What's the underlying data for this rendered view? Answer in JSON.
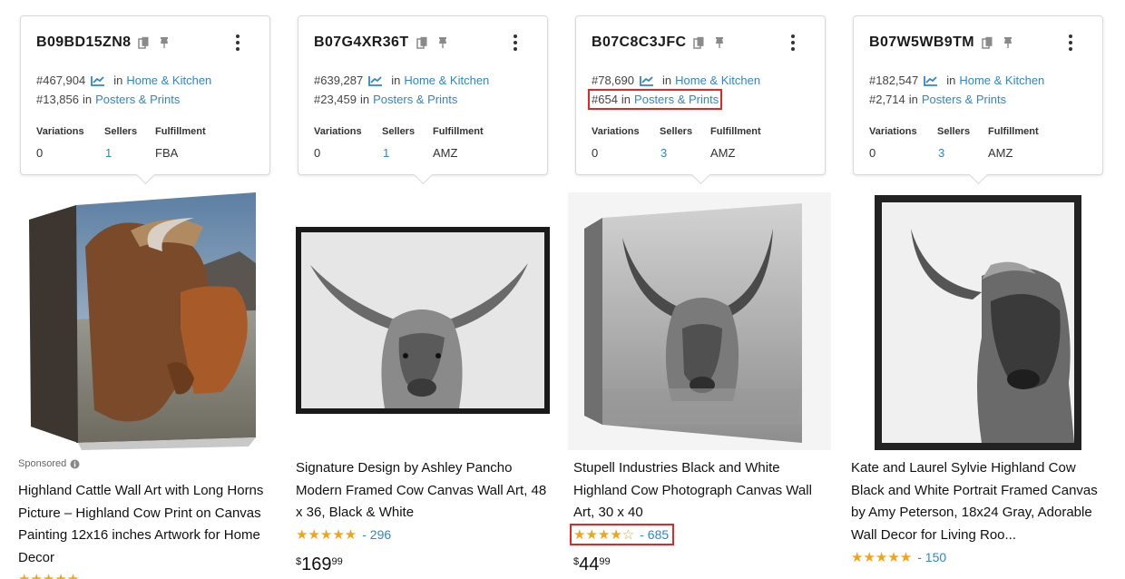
{
  "products": [
    {
      "asin": "B09BD15ZN8",
      "rank_main": "#467,904",
      "in_label": "in",
      "cat_main": "Home & Kitchen",
      "rank_sub": "#13,856",
      "cat_sub": "Posters & Prints",
      "variations_label": "Variations",
      "sellers_label": "Sellers",
      "fulfillment_label": "Fulfillment",
      "variations": "0",
      "sellers": "1",
      "fulfillment": "FBA",
      "sponsored": "Sponsored",
      "title": "Highland Cattle Wall Art with Long Horns Picture – Highland Cow Print on Canvas Painting 12x16 inches Artwork for Home Decor",
      "stars": "★★★★★",
      "stars_rating": 4.5
    },
    {
      "asin": "B07G4XR36T",
      "rank_main": "#639,287",
      "in_label": "in",
      "cat_main": "Home & Kitchen",
      "rank_sub": "#23,459",
      "cat_sub": "Posters & Prints",
      "variations_label": "Variations",
      "sellers_label": "Sellers",
      "fulfillment_label": "Fulfillment",
      "variations": "0",
      "sellers": "1",
      "fulfillment": "AMZ",
      "title": "Signature Design by Ashley Pancho Modern Framed Cow Canvas Wall Art, 48 x 36, Black & White",
      "stars": "★★★★★",
      "stars_rating": 5,
      "review_count": "- 296",
      "price_symbol": "$",
      "price_whole": "169",
      "price_cents": "99"
    },
    {
      "asin": "B07C8C3JFC",
      "rank_main": "#78,690",
      "in_label": "in",
      "cat_main": "Home & Kitchen",
      "rank_sub": "#654",
      "cat_sub": "Posters & Prints",
      "variations_label": "Variations",
      "sellers_label": "Sellers",
      "fulfillment_label": "Fulfillment",
      "variations": "0",
      "sellers": "3",
      "fulfillment": "AMZ",
      "title": "Stupell Industries Black and White Highland Cow Photograph Canvas Wall Art, 30 x 40",
      "stars": "★★★★☆",
      "stars_rating": 4.5,
      "review_count": "- 685",
      "price_symbol": "$",
      "price_whole": "44",
      "price_cents": "99"
    },
    {
      "asin": "B07W5WB9TM",
      "rank_main": "#182,547",
      "in_label": "in",
      "cat_main": "Home & Kitchen",
      "rank_sub": "#2,714",
      "cat_sub": "Posters & Prints",
      "variations_label": "Variations",
      "sellers_label": "Sellers",
      "fulfillment_label": "Fulfillment",
      "variations": "0",
      "sellers": "3",
      "fulfillment": "AMZ",
      "title": "Kate and Laurel Sylvie Highland Cow Black and White Portrait Framed Canvas by Amy Peterson, 18x24 Gray, Adorable Wall Decor for Living Roo...",
      "stars": "★★★★★",
      "stars_rating": 5,
      "review_count": "- 150"
    }
  ],
  "colors": {
    "link": "#2f86c9",
    "star": "#f0a41b",
    "highlight": "#e32626"
  }
}
